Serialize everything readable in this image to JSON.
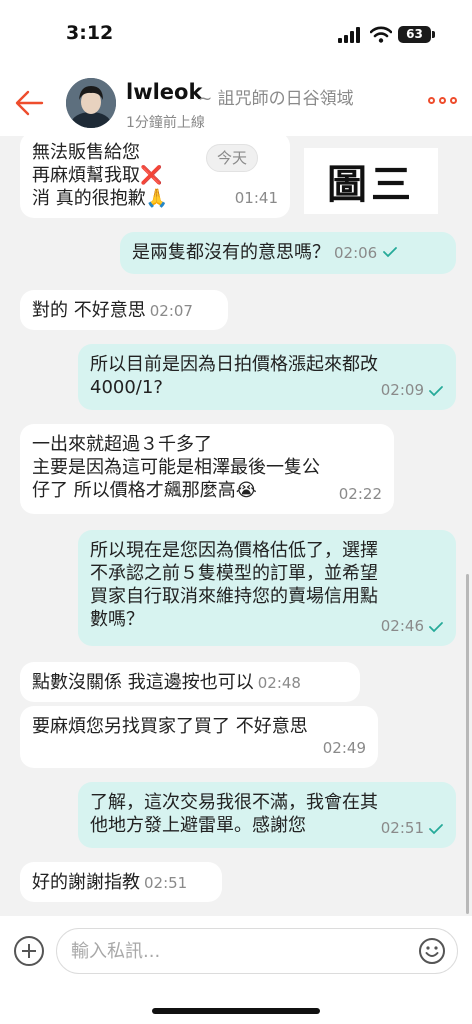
{
  "status_bar": {
    "time": "3:12",
    "battery": "63"
  },
  "header": {
    "username": "lwleok",
    "shop_name": "~ 詛咒師の日谷領域",
    "last_online": "1分鐘前上線"
  },
  "chat": {
    "date_label": "今天",
    "image_caption": "圖三",
    "messages": [
      {
        "side": "in",
        "text": "無法販售給您\n再麻煩幫我取❌\n消 真的很抱歉🙏",
        "time": "01:41"
      },
      {
        "side": "out",
        "text": "是兩隻都沒有的意思嗎？",
        "time": "02:06"
      },
      {
        "side": "in",
        "text": "對的 不好意思",
        "time": "02:07"
      },
      {
        "side": "out",
        "text": "所以目前是因為日拍價格漲起來都改\n4000/1?",
        "time": "02:09"
      },
      {
        "side": "in",
        "text": "一出來就超過３千多了\n主要是因為這可能是相澤最後一隻公\n仔了 所以價格才飆那麼高😭",
        "time": "02:22"
      },
      {
        "side": "out",
        "text": "所以現在是您因為價格估低了，選擇\n不承認之前５隻模型的訂單，並希望\n買家自行取消來維持您的賣場信用點\n數嗎？",
        "time": "02:46"
      },
      {
        "side": "in",
        "text": "點數沒關係 我這邊按也可以",
        "time": "02:48"
      },
      {
        "side": "in",
        "text": "要麻煩您另找買家了買了 不好意思",
        "time": "02:49"
      },
      {
        "side": "out",
        "text": "了解，這次交易我很不滿，我會在其\n他地方發上避雷單。感謝您",
        "time": "02:51"
      },
      {
        "side": "in",
        "text": "好的謝謝指教",
        "time": "02:51"
      }
    ]
  },
  "input": {
    "placeholder": "輸入私訊..."
  },
  "colors": {
    "accent": "#ee4d2d",
    "outgoing_bubble": "#d7f3f0",
    "read_check": "#26aa99"
  }
}
